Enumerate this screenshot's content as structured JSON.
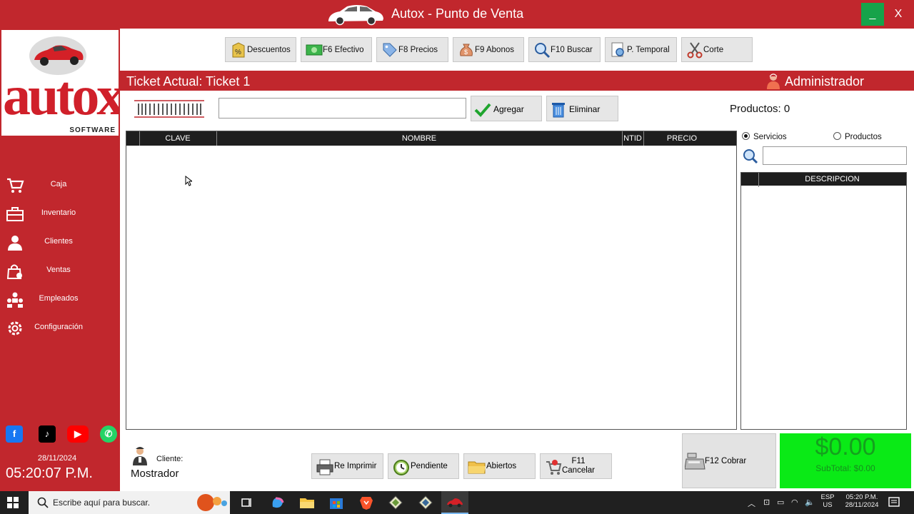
{
  "window": {
    "title": "Autox - Punto de Venta",
    "minimize": "_",
    "close": "X"
  },
  "logo": {
    "text": "autox",
    "sub": "SOFTWARE"
  },
  "sidebar": {
    "items": [
      {
        "label": "Caja",
        "icon": "cart-icon"
      },
      {
        "label": "Inventario",
        "icon": "briefcase-icon"
      },
      {
        "label": "Clientes",
        "icon": "person-icon"
      },
      {
        "label": "Ventas",
        "icon": "bag-icon"
      },
      {
        "label": "Empleados",
        "icon": "people-icon"
      },
      {
        "label": "Configuración",
        "icon": "gear-icon"
      }
    ],
    "social": [
      "facebook-icon",
      "tiktok-icon",
      "youtube-icon",
      "whatsapp-icon"
    ],
    "date": "28/11/2024",
    "time": "05:20:07 P.M."
  },
  "toolbar": {
    "descuentos": "Descuentos",
    "efectivo": "F6 Efectivo",
    "precios": "F8 Precios",
    "abonos": "F9 Abonos",
    "buscar": "F10 Buscar",
    "temporal": "P. Temporal",
    "corte": "Corte"
  },
  "ticket": {
    "title": "Ticket Actual: Ticket 1",
    "user": "Administrador"
  },
  "entry": {
    "code_value": "",
    "agregar": "Agregar",
    "eliminar": "Eliminar",
    "products_count": "Productos: 0"
  },
  "main_table": {
    "columns": [
      "CLAVE",
      "NOMBRE",
      "NTID",
      "PRECIO"
    ],
    "rows": []
  },
  "right_panel": {
    "radio_servicios": "Servicios",
    "radio_productos": "Productos",
    "selected": "Servicios",
    "search_value": "",
    "columns": [
      "DESCRIPCION"
    ]
  },
  "bottom": {
    "cliente_label": "Cliente:",
    "cliente_value": "Mostrador",
    "reimprimir": "Re Imprimir",
    "pendiente": "Pendiente",
    "abiertos": "Abiertos",
    "cancelar_line1": "F11",
    "cancelar_line2": "Cancelar",
    "cobrar": "F12 Cobrar",
    "total": "$0.00",
    "subtotal": "SubTotal: $0.00"
  },
  "colors": {
    "brand_red": "#c1272d",
    "total_green": "#0aea16",
    "header_dark": "#1e1e1e"
  },
  "taskbar": {
    "search_placeholder": "Escribe aquí para buscar.",
    "lang1": "ESP",
    "lang2": "US",
    "time": "05:20 P.M.",
    "date": "28/11/2024"
  }
}
